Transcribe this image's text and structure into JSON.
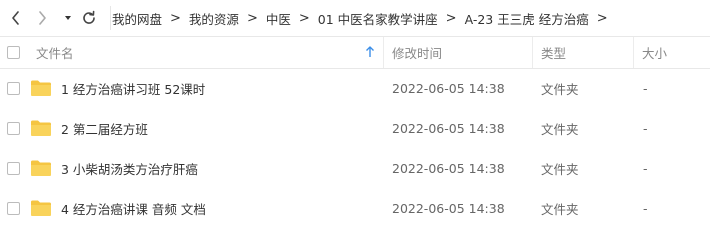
{
  "toolbar": {
    "back_icon": "chevron-left-icon",
    "forward_icon": "chevron-right-icon",
    "history_icon": "caret-down-icon",
    "refresh_icon": "refresh-icon"
  },
  "breadcrumb": {
    "items": [
      "我的网盘",
      "我的资源",
      "中医",
      "01 中医名家教学讲座",
      "A-23 王三虎 经方治癌"
    ],
    "separator": ">"
  },
  "table": {
    "columns": {
      "name": "文件名",
      "modified": "修改时间",
      "type": "类型",
      "size": "大小"
    },
    "sort_icon": "arrow-up-icon",
    "rows": [
      {
        "name": "1 经方治癌讲习班 52课时",
        "modified": "2022-06-05 14:38",
        "type": "文件夹",
        "size": "-"
      },
      {
        "name": "2 第二届经方班",
        "modified": "2022-06-05 14:38",
        "type": "文件夹",
        "size": "-"
      },
      {
        "name": "3 小柴胡汤类方治疗肝癌",
        "modified": "2022-06-05 14:38",
        "type": "文件夹",
        "size": "-"
      },
      {
        "name": "4 经方治癌讲课 音频 文档",
        "modified": "2022-06-05 14:38",
        "type": "文件夹",
        "size": "-"
      }
    ]
  },
  "colors": {
    "folder": "#f5c542",
    "sort_arrow": "#3b8ee8"
  }
}
